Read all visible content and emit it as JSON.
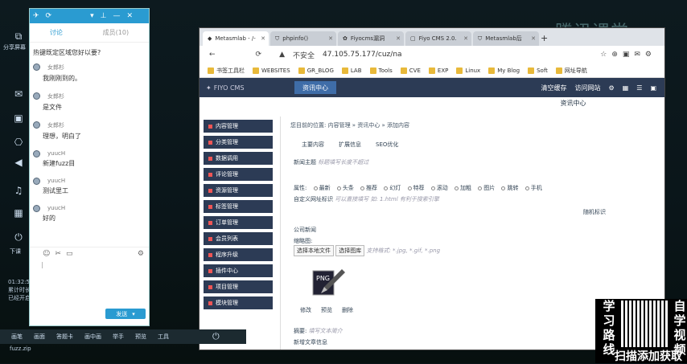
{
  "watermark": "腾讯课堂",
  "left_tool": {
    "share_label": "分享屏幕",
    "exit_label": "下课",
    "time": "01:32:50",
    "time_note1": "累计时长",
    "time_note2": "已经开启"
  },
  "chat": {
    "tabs": [
      "讨论",
      "成员(10)"
    ],
    "question": "热键既定区域您好以要?",
    "messages": [
      {
        "who": "女郎杉",
        "text": "我刚刚到的。"
      },
      {
        "who": "女郎杉",
        "text": "是文件"
      },
      {
        "who": "女郎杉",
        "text": "理想，明白了"
      },
      {
        "who": "yuucH",
        "text": "新建fuzz目"
      },
      {
        "who": "yuucH",
        "text": "测试里工"
      },
      {
        "who": "yuucH",
        "text": "好的"
      }
    ],
    "send_label": "发送"
  },
  "browser": {
    "tabs": [
      "Metasmlab - /-",
      "phpinfo()",
      "Fiyocms漏洞",
      "Fiyo CMS 2.0.",
      "Metasmlab后"
    ],
    "insecure": "不安全",
    "url": "47.105.75.177/cuz/na",
    "bookmarks": [
      "书签工具栏",
      "WEBSITES",
      "GR_BLOG",
      "LAB",
      "Tools",
      "CVE",
      "EXP",
      "Linux",
      "My Blog",
      "Soft",
      "网址导航"
    ]
  },
  "cms": {
    "logo": "FIYO CMS",
    "active_tab": "资讯中心",
    "right_links": [
      "清空缓存",
      "访问网站"
    ],
    "content_title": "资讯中心",
    "breadcrumb": "您目前的位置: 内容管理 » 资讯中心 » 添加内容",
    "nav": [
      "内容管理",
      "分类管理",
      "数据调用",
      "评论管理",
      "资源管理",
      "标签管理",
      "订单管理",
      "会员列表",
      "程序升级",
      "插件中心",
      "项目管理",
      "模块管理"
    ],
    "subtabs": [
      "主要内容",
      "扩展信息",
      "SEO优化"
    ],
    "title_label": "新闻主题",
    "title_placeholder": "标题填写长度不超过",
    "attr_label": "属性:",
    "attrs": [
      "最新",
      "头条",
      "推荐",
      "幻灯",
      "特荐",
      "滚动",
      "加粗",
      "图片",
      "跳转",
      "手机"
    ],
    "custom_label": "自定义网址标识",
    "custom_hint": "可以直接填写 如: 1.html 有利于搜索引擎",
    "random_label": "随机标识",
    "pub_label": "公司新闻",
    "thumb_label": "缩略图:",
    "upload_label": "选择本地文件",
    "select_img": "选择图库",
    "img_hint": "支持格式: *.jpg, *.gif, *.png",
    "img_actions": [
      "修改",
      "预览",
      "删除"
    ],
    "summary_label": "摘要:",
    "summary_hint": "填写文本简介",
    "extra": "新增文章信息"
  },
  "taskbar": [
    "画笔",
    "画面",
    "答题卡",
    "画中画",
    "举手",
    "预览",
    "工具"
  ],
  "file": "fuzz.zip",
  "promo": {
    "left": "学习路线",
    "right": "自学视频",
    "bottom": "扫描添加获取"
  }
}
